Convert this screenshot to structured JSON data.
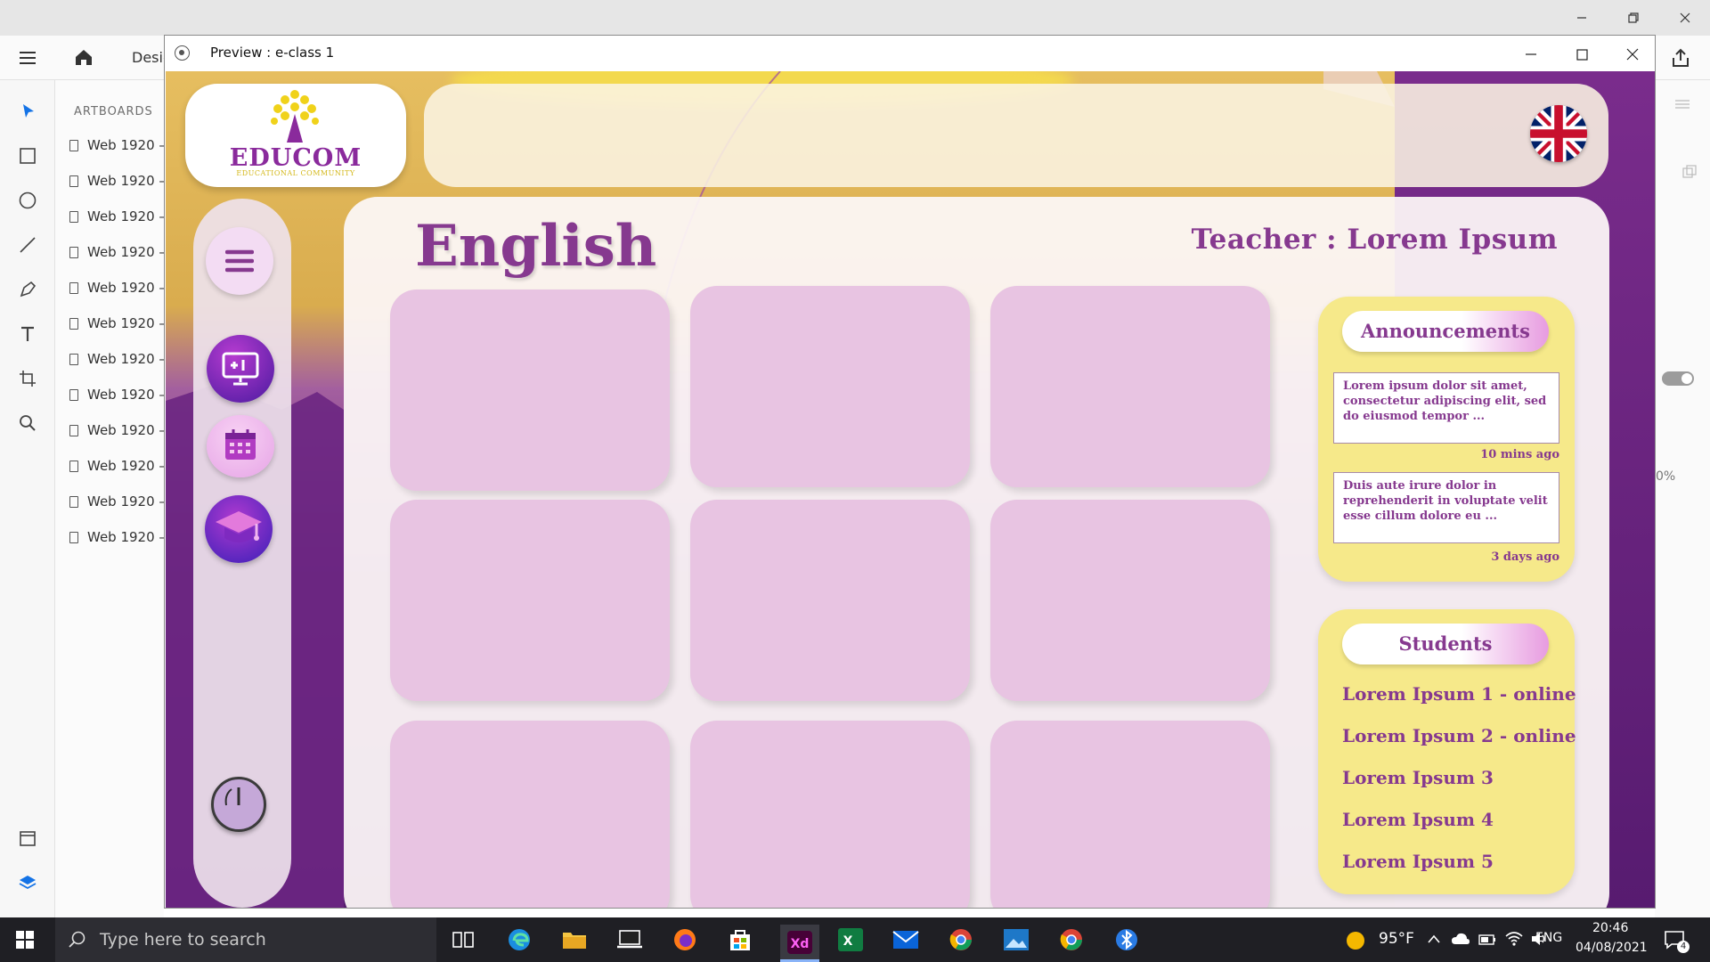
{
  "xd": {
    "tab_partial": "Desig",
    "artboards_header": "ARTBOARDS",
    "artboards": [
      "Web 1920 –",
      "Web 1920 –",
      "Web 1920 –",
      "Web 1920 –",
      "Web 1920 –",
      "Web 1920 –",
      "Web 1920 –",
      "Web 1920 –",
      "Web 1920 –",
      "Web 1920 –",
      "Web 1920 –",
      "Web 1920 –"
    ],
    "right_partial": "0%"
  },
  "preview": {
    "title": "Preview : e-class 1"
  },
  "app": {
    "logo_name": "EDUCOM",
    "logo_tagline": "EDUCATIONAL COMMUNITY",
    "language_flag": "uk-flag-icon",
    "subject": "English",
    "teacher": "Teacher : Lorem Ipsum",
    "nav": [
      "menu-icon",
      "whiteboard-icon",
      "calendar-icon",
      "graduation-cap-icon",
      "power-icon"
    ],
    "announcements": {
      "title": "Announcements",
      "items": [
        {
          "text": "Lorem ipsum dolor sit amet, consectetur adipiscing elit, sed do eiusmod tempor ...",
          "time": "10 mins ago"
        },
        {
          "text": "Duis aute irure dolor in reprehenderit in voluptate velit esse cillum dolore eu ...",
          "time": "3 days ago"
        }
      ]
    },
    "students": {
      "title": "Students",
      "list": [
        "Lorem Ipsum 1 - online",
        "Lorem Ipsum 2 - online",
        "Lorem Ipsum 3",
        "Lorem Ipsum 4",
        "Lorem Ipsum 5"
      ]
    }
  },
  "taskbar": {
    "search_placeholder": "Type here to search",
    "weather": "95°F",
    "language": "ENG",
    "time": "20:46",
    "date": "04/08/2021",
    "notifications": "4"
  },
  "colors": {
    "brand_purple": "#86398f",
    "tile": "#e8c4e2",
    "card_yellow": "#f6e98a"
  }
}
